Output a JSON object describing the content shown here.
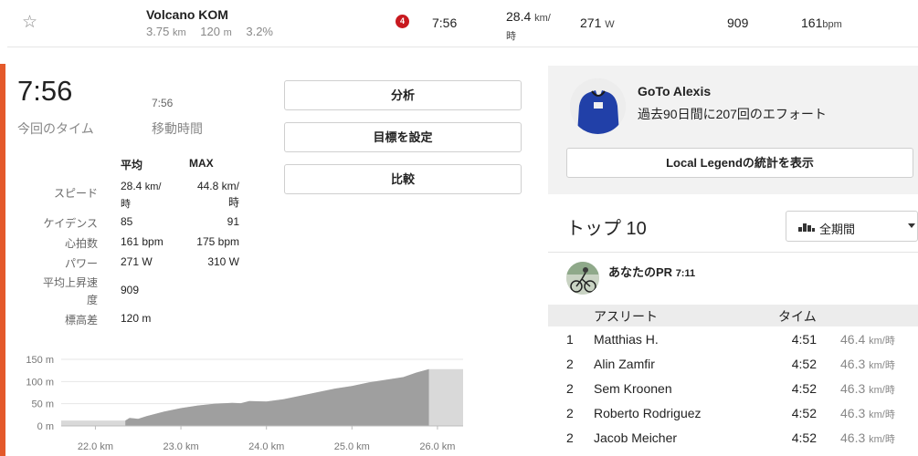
{
  "segment": {
    "star_icon": "star-outline-icon",
    "name": "Volcano KOM",
    "distance": "3.75",
    "distance_unit": "km",
    "elevation": "120",
    "elevation_unit": "m",
    "grade": "3.2%",
    "rank_badge": "4",
    "time": "7:56",
    "speed": "28.4",
    "speed_unit_line1": "km/",
    "speed_unit_line2": "時",
    "power": "271",
    "power_unit": "W",
    "vam": "909",
    "heart_rate": "161",
    "heart_rate_unit": "bpm"
  },
  "effort": {
    "elapsed_time": "7:56",
    "moving_time": "7:56",
    "elapsed_label": "今回のタイム",
    "moving_label": "移動時間"
  },
  "actions": {
    "analyze": "分析",
    "set_goal": "目標を設定",
    "compare": "比較"
  },
  "stats": {
    "avg_header": "平均",
    "max_header": "MAX",
    "rows": [
      {
        "label": "スピード",
        "avg": "28.4",
        "avg_unit": "km/",
        "avg_unit2": "時",
        "max": "44.8",
        "max_unit": "km/",
        "max_unit2": "時"
      },
      {
        "label": "ケイデンス",
        "avg": "85",
        "max": "91"
      },
      {
        "label": "心拍数",
        "avg": "161 bpm",
        "max": "175 bpm"
      },
      {
        "label": "パワー",
        "avg": "271 W",
        "max": "310 W"
      },
      {
        "label": "平均上昇速",
        "label2": "度",
        "avg": "909"
      },
      {
        "label": "標高差",
        "avg": "120 m"
      }
    ]
  },
  "chart_data": {
    "type": "area",
    "x": [
      21.6,
      22.0,
      22.35,
      22.4,
      22.5,
      22.6,
      22.8,
      23.0,
      23.2,
      23.4,
      23.6,
      23.7,
      23.8,
      24.0,
      24.2,
      24.4,
      24.6,
      24.8,
      25.0,
      25.2,
      25.4,
      25.6,
      25.75,
      25.9,
      26.0,
      26.3
    ],
    "y": [
      12,
      12,
      12,
      18,
      16,
      22,
      32,
      40,
      46,
      50,
      52,
      51,
      56,
      55,
      60,
      68,
      76,
      84,
      90,
      98,
      104,
      110,
      120,
      128,
      128,
      128
    ],
    "highlight_range": [
      22.35,
      25.9
    ],
    "y_ticks": [
      "150 m",
      "100 m",
      "50 m",
      "0 m"
    ],
    "y_tick_values": [
      150,
      100,
      50,
      0
    ],
    "x_ticks": [
      "22.0 km",
      "23.0 km",
      "24.0 km",
      "25.0 km",
      "26.0 km"
    ],
    "x_tick_values": [
      22.0,
      23.0,
      24.0,
      25.0,
      26.0
    ],
    "xlim": [
      21.6,
      26.3
    ],
    "ylim": [
      0,
      150
    ]
  },
  "local_legend": {
    "name": "GoTo Alexis",
    "efforts": "過去90日間に207回のエフォート",
    "stats_button": "Local Legendの統計を表示"
  },
  "leaderboard": {
    "title": "トップ 10",
    "period": "全期間",
    "pr_label": "あなたのPR",
    "pr_time": "7:11",
    "col_athlete": "アスリート",
    "col_time": "タイム",
    "rows": [
      {
        "rank": "1",
        "name": "Matthias H.",
        "time": "4:51",
        "speed": "46.4",
        "unit": "km/時"
      },
      {
        "rank": "2",
        "name": "Alin Zamfir",
        "time": "4:52",
        "speed": "46.3",
        "unit": "km/時"
      },
      {
        "rank": "2",
        "name": "Sem Kroonen",
        "time": "4:52",
        "speed": "46.3",
        "unit": "km/時"
      },
      {
        "rank": "2",
        "name": "Roberto Rodriguez",
        "time": "4:52",
        "speed": "46.3",
        "unit": "km/時"
      },
      {
        "rank": "2",
        "name": "Jacob Meicher",
        "time": "4:52",
        "speed": "46.3",
        "unit": "km/時"
      }
    ]
  },
  "colors": {
    "accent": "#e4592a",
    "badge": "#c8191f"
  }
}
